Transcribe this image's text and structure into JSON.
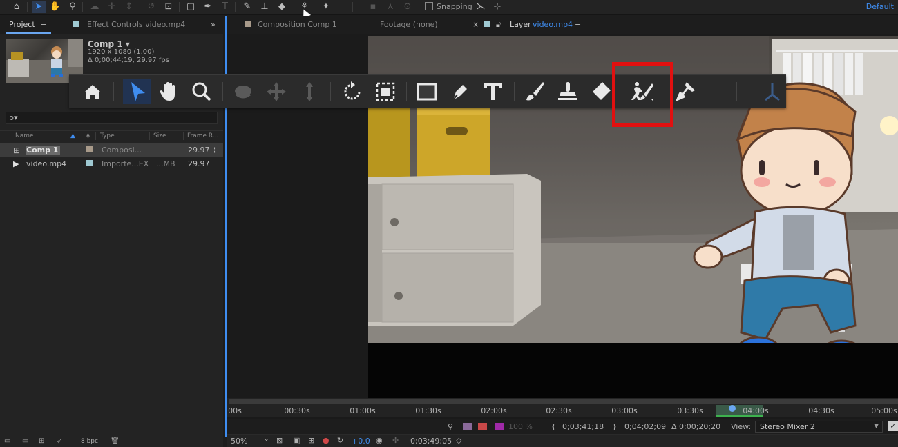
{
  "top_toolbar": {
    "tools": [
      "home-icon",
      "selection-arrow-icon",
      "hand-icon",
      "zoom-icon",
      "orbit-icon",
      "pan-icon",
      "dolly-icon",
      "rotate-icon",
      "pan-behind-icon",
      "rectangle-icon",
      "pen-icon",
      "type-icon",
      "brush-icon",
      "clone-stamp-icon",
      "eraser-icon",
      "roto-brush-icon",
      "puppet-pin-icon"
    ],
    "snapping_label": "Snapping",
    "workspace_label": "Default"
  },
  "project_panel": {
    "tab_project": "Project",
    "tab_effect_controls": "Effect Controls video.mp4",
    "comp_name": "Comp 1 ▾",
    "comp_resolution": "1920 x 1080 (1.00)",
    "comp_duration": "Δ 0;00;44;19, 29.97 fps",
    "search_placeholder": "ρ▾",
    "columns": {
      "name": "Name",
      "type": "Type",
      "size": "Size",
      "frame_rate": "Frame R..."
    },
    "rows": [
      {
        "name": "Comp 1",
        "type": "Composi...",
        "size": "",
        "frame_rate": "29.97",
        "swatch": "#a89a8a"
      },
      {
        "name": "video.mp4",
        "type": "Importe...EX",
        "size": "...MB",
        "frame_rate": "29.97",
        "swatch": "#9fc9d2"
      }
    ],
    "footer_bpc": "8 bpc"
  },
  "viewer": {
    "tab_composition": "Composition Comp 1",
    "tab_footage": "Footage (none)",
    "tab_layer_prefix": "Layer",
    "tab_layer_name": "video.mp4",
    "timeline_labels": [
      "00s",
      "00:30s",
      "01:00s",
      "01:30s",
      "02:00s",
      "02:30s",
      "03:00s",
      "03:30s",
      "04:00s",
      "04:30s",
      "05:00s"
    ],
    "layer_controls": {
      "opacity": "100 %",
      "in_point": "0;03;41;18",
      "out_point": "0;04;02;09",
      "duration": "Δ 0;00;20;20",
      "view_label": "View:",
      "view_value": "Stereo Mixer 2"
    },
    "footer": {
      "zoom": "50%",
      "exposure": "+0.0",
      "timecode": "0;03;49;05"
    }
  },
  "colors": {
    "accent_blue": "#3f8df0",
    "highlight_red": "#e11010",
    "work_area_green": "#3db24e"
  }
}
